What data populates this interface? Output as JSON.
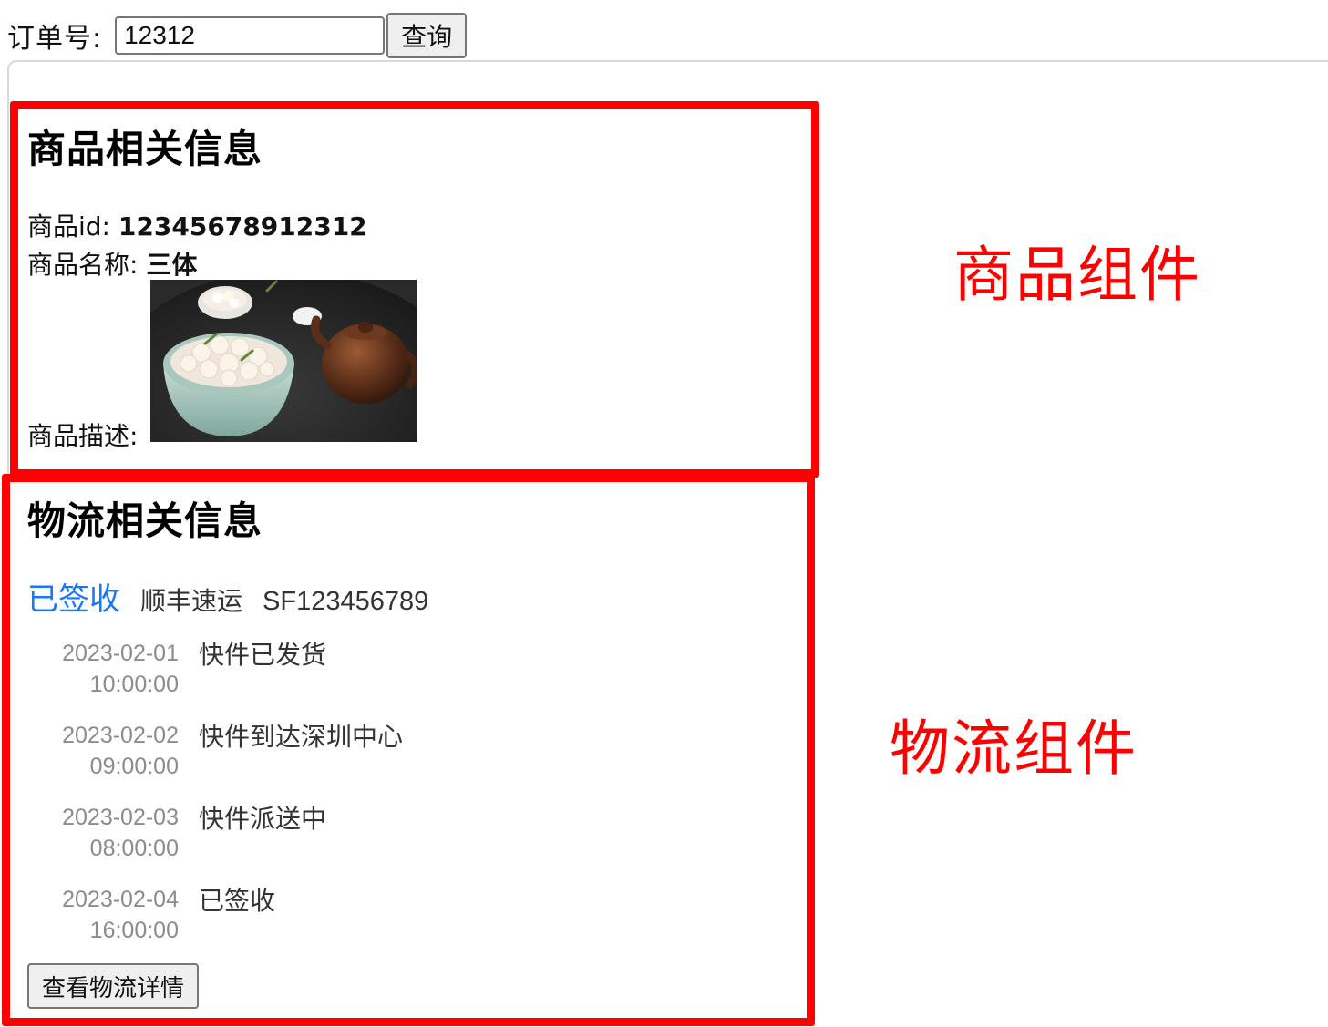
{
  "search": {
    "label": "订单号:",
    "value": "12312",
    "button_label": "查询"
  },
  "product": {
    "title": "商品相关信息",
    "id_label": "商品id:",
    "id_value": "12345678912312",
    "name_label": "商品名称:",
    "name_value": "三体",
    "desc_label": "商品描述:"
  },
  "logistics": {
    "title": "物流相关信息",
    "status": "已签收",
    "carrier": "顺丰速运",
    "tracking_number": "SF123456789",
    "events": [
      {
        "date": "2023-02-01",
        "time": "10:00:00",
        "desc": "快件已发货"
      },
      {
        "date": "2023-02-02",
        "time": "09:00:00",
        "desc": "快件到达深圳中心"
      },
      {
        "date": "2023-02-03",
        "time": "08:00:00",
        "desc": "快件派送中"
      },
      {
        "date": "2023-02-04",
        "time": "16:00:00",
        "desc": "已签收"
      }
    ],
    "details_button": "查看物流详情"
  },
  "annotations": {
    "product_component": "商品组件",
    "logistics_component": "物流组件"
  },
  "colors": {
    "annotation_red": "#ff0000",
    "status_blue": "#1677ff",
    "timestamp_gray": "#8c8c8c"
  }
}
